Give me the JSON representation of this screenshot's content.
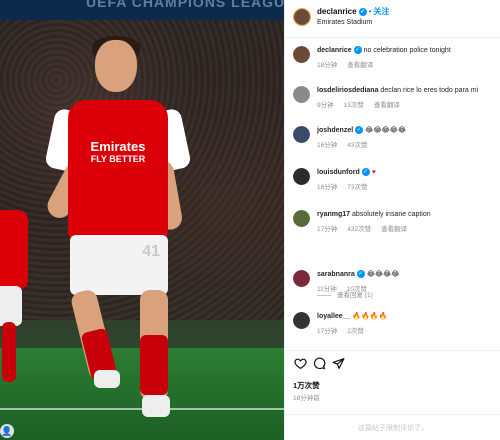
{
  "post": {
    "username": "declanrice",
    "separator": "•",
    "follow_label": "关注",
    "location": "Emirates Stadium",
    "photo_banner_text": "UEFA CHAMPIONS LEAGUE",
    "jersey_sponsor": "Emirates",
    "jersey_sponsor_sub": "FLY BETTER",
    "shorts_number": "41"
  },
  "comments": [
    {
      "username": "declanrice",
      "text": "no celebration police tonight",
      "time": "18分钟",
      "likes": "",
      "reply": "查看翻译",
      "verified": true,
      "avatar_color": "#6b4a3a"
    },
    {
      "username": "losdeliriosdediana",
      "text": "declan rice lo eres todo para mi",
      "time": "9分钟",
      "likes": "13次赞",
      "reply": "查看翻译",
      "verified": false,
      "avatar_color": "#8a8a8a"
    },
    {
      "username": "joshdenzel",
      "text": "😂😂😂😂😂",
      "time": "16分钟",
      "likes": "43次赞",
      "reply": "",
      "verified": true,
      "avatar_color": "#3a4a6a"
    },
    {
      "username": "louisdunford",
      "text": "♥",
      "time": "16分钟",
      "likes": "73次赞",
      "reply": "",
      "verified": true,
      "avatar_color": "#2a2a2a"
    },
    {
      "username": "ryanmg17",
      "text": "absolutely insane caption",
      "time": "17分钟",
      "likes": "432次赞",
      "reply": "查看翻译",
      "verified": false,
      "avatar_color": "#5a6a3a"
    },
    {
      "username": "sarabnanra",
      "text": "😂😂😂😂",
      "time": "11分钟",
      "likes": "10次赞",
      "reply": "",
      "verified": true,
      "avatar_color": "#7a2a3a"
    },
    {
      "username": "loyallee__",
      "text": "🔥🔥🔥🔥",
      "time": "17分钟",
      "likes": "2次赞",
      "reply": "",
      "verified": false,
      "avatar_color": "#333333"
    }
  ],
  "view_replies": "查看回复 (1)",
  "actions": {
    "like_icon": "heart-icon",
    "comment_icon": "comment-icon",
    "share_icon": "share-icon",
    "likes_count": "1万次赞",
    "posted_ago": "18分钟前"
  },
  "add_comment": {
    "placeholder": "这篇帖子限制评论了。"
  },
  "colors": {
    "accent": "#0095f6",
    "arsenal_red": "#db0007"
  }
}
